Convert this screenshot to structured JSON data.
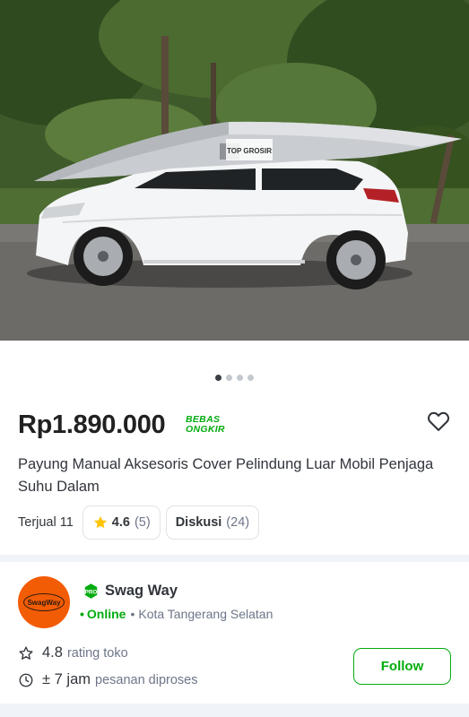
{
  "product": {
    "image_alt": "white hatchback with silver umbrella car cover",
    "image_count": 4,
    "active_image_index": 0,
    "price": "Rp1.890.000",
    "free_shipping_line1": "BEBAS",
    "free_shipping_line2": "ONGKIR",
    "title": "Payung Manual Aksesoris Cover Pelindung Luar Mobil Penjaga Suhu Dalam",
    "sold_label": "Terjual 11",
    "rating": "4.6",
    "rating_count": "(5)",
    "discussion_label": "Diskusi",
    "discussion_count": "(24)",
    "wishlist_icon": "heart-outline-icon",
    "cover_brand": "TOP GROSIR"
  },
  "shop": {
    "logo_text": "SwagWay",
    "name": "Swag Way",
    "badge": "PRO",
    "status": "Online",
    "city": "Kota Tangerang Selatan",
    "rating": "4.8",
    "rating_label": "rating toko",
    "process_time": "± 7 jam",
    "process_label": "pesanan diproses",
    "follow_label": "Follow"
  },
  "colors": {
    "brand_green": "#03ac0e",
    "star_yellow": "#ffc400",
    "shop_logo_orange": "#f25c05"
  }
}
